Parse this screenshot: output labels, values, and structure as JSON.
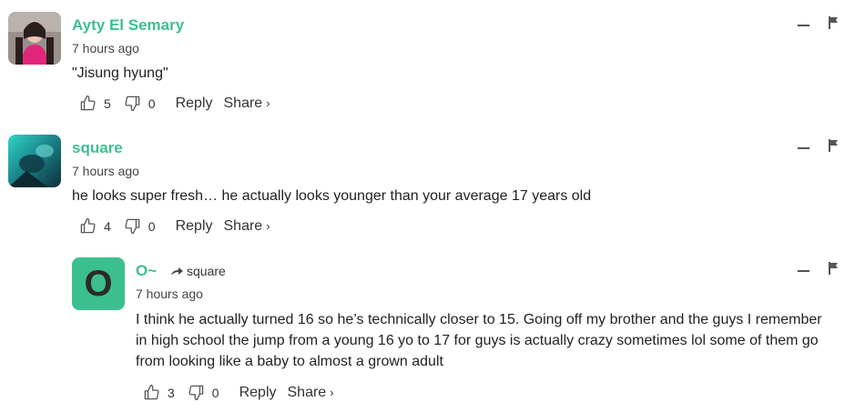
{
  "comments": [
    {
      "author": "Ayty El Semary",
      "time": "7 hours ago",
      "text": "\"Jisung hyung\"",
      "upvotes": "5",
      "downvotes": "0",
      "reply_label": "Reply",
      "share_label": "Share",
      "share_chevron": "›"
    },
    {
      "author": "square",
      "time": "7 hours ago",
      "text": "he looks super fresh… he actually looks younger than your average 17 years old",
      "upvotes": "4",
      "downvotes": "0",
      "reply_label": "Reply",
      "share_label": "Share",
      "share_chevron": "›"
    },
    {
      "author": "O~",
      "avatar_letter": "O",
      "reply_to": "square",
      "time": "7 hours ago",
      "text_lines": [
        "I think he actually turned 16 so he’s technically closer to 15. Going off my brother and the guys I remember",
        "in high school the jump from a young 16 yo to 17 for guys is actually crazy sometimes lol some of them go",
        "from looking like a baby to almost a grown adult"
      ],
      "upvotes": "3",
      "downvotes": "0",
      "reply_label": "Reply",
      "share_label": "Share",
      "share_chevron": "›"
    }
  ],
  "colors": {
    "accent": "#3cbf8f",
    "text": "#222222",
    "icon": "#555555"
  }
}
